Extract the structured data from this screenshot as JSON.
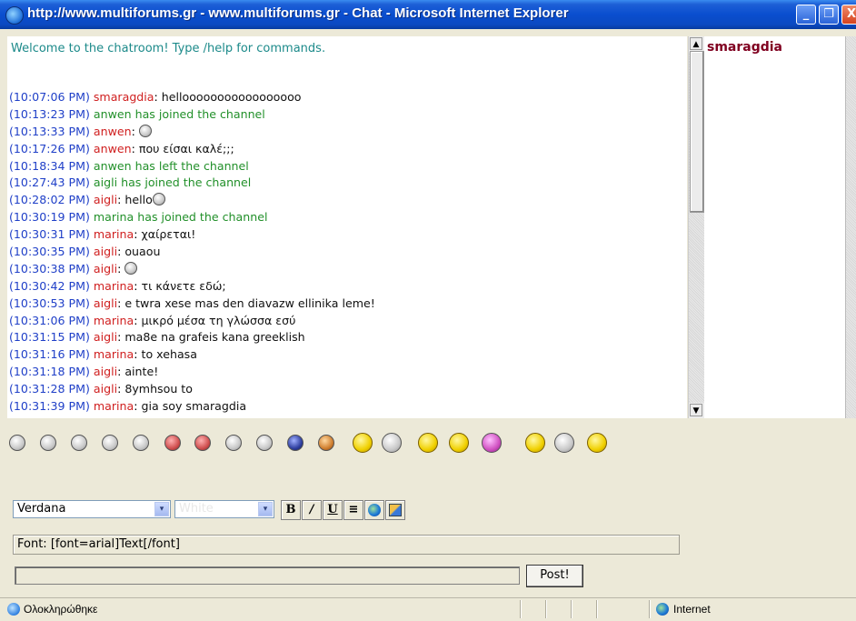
{
  "window": {
    "title": "http://www.multiforums.gr - www.multiforums.gr - Chat - Microsoft Internet Explorer",
    "min_glyph": "_",
    "max_glyph": "❐",
    "close_glyph": "X"
  },
  "chat": {
    "welcome": "Welcome to the chatroom! Type /help for commands.",
    "messages": [
      {
        "time": "(10:07:06 PM)",
        "nick": "smaragdia",
        "text": "hellooooooooooooooooo"
      },
      {
        "time": "(10:13:23 PM)",
        "system": "anwen has joined the channel"
      },
      {
        "time": "(10:13:33 PM)",
        "nick": "anwen",
        "text": "",
        "smiley": true
      },
      {
        "time": "(10:17:26 PM)",
        "nick": "anwen",
        "text": "που είσαι καλέ;;;"
      },
      {
        "time": "(10:18:34 PM)",
        "system": "anwen has left the channel"
      },
      {
        "time": "(10:27:43 PM)",
        "system": "aigli has joined the channel"
      },
      {
        "time": "(10:28:02 PM)",
        "nick": "aigli",
        "text": "hello",
        "smiley": true
      },
      {
        "time": "(10:30:19 PM)",
        "system": "marina has joined the channel"
      },
      {
        "time": "(10:30:31 PM)",
        "nick": "marina",
        "text": "χαίρεται!"
      },
      {
        "time": "(10:30:35 PM)",
        "nick": "aigli",
        "text": "ouaou"
      },
      {
        "time": "(10:30:38 PM)",
        "nick": "aigli",
        "text": "",
        "smiley": true
      },
      {
        "time": "(10:30:42 PM)",
        "nick": "marina",
        "text": "τι κάνετε εδώ;"
      },
      {
        "time": "(10:30:53 PM)",
        "nick": "aigli",
        "text": "e twra xese mas den diavazw ellinika leme!"
      },
      {
        "time": "(10:31:06 PM)",
        "nick": "marina",
        "text": "μικρό μέσα τη γλώσσα εσύ"
      },
      {
        "time": "(10:31:15 PM)",
        "nick": "aigli",
        "text": "ma8e na grafeis kana greeklish"
      },
      {
        "time": "(10:31:16 PM)",
        "nick": "marina",
        "text": "to xehasa"
      },
      {
        "time": "(10:31:18 PM)",
        "nick": "aigli",
        "text": "ainte!"
      },
      {
        "time": "(10:31:28 PM)",
        "nick": "aigli",
        "text": "8ymhsou to"
      },
      {
        "time": "(10:31:39 PM)",
        "nick": "marina",
        "text": "gia soy smaragdia"
      }
    ]
  },
  "users": {
    "list": [
      "smaragdia"
    ]
  },
  "emoticons": [
    {
      "name": "smile-emoticon",
      "style": ""
    },
    {
      "name": "sad-emoticon",
      "style": ""
    },
    {
      "name": "grin-emoticon",
      "style": ""
    },
    {
      "name": "happy-emoticon",
      "style": ""
    },
    {
      "name": "cool-emoticon",
      "style": ""
    },
    {
      "name": "angry-emoticon",
      "style": "d"
    },
    {
      "name": "shocked-emoticon",
      "style": "d"
    },
    {
      "name": "wow-emoticon",
      "style": ""
    },
    {
      "name": "tongue-emoticon",
      "style": ""
    },
    {
      "name": "ninja-emoticon",
      "style": "b"
    },
    {
      "name": "hat-emoticon",
      "style": "o"
    },
    {
      "name": "pair-emoticon",
      "style": "y"
    },
    {
      "name": "question-emoticon",
      "style": ""
    },
    {
      "name": "sign-emoticon",
      "style": "y"
    },
    {
      "name": "thumbsup-emoticon",
      "style": "y"
    },
    {
      "name": "cheerleader-emoticon",
      "style": "p"
    },
    {
      "name": "sunglasses-emoticon",
      "style": "y"
    },
    {
      "name": "confused-emoticon",
      "style": ""
    },
    {
      "name": "rock-emoticon",
      "style": "y"
    }
  ],
  "toolbar": {
    "font_select": "Verdana",
    "color_select": "White",
    "bold": "B",
    "italic": "/",
    "underline": "U",
    "align_glyph": "≡",
    "arrow_glyph": "▾"
  },
  "font_help": "Font: [font=arial]Text[/font]",
  "input": {
    "value": "",
    "post_label": "Post!"
  },
  "statusbar": {
    "text": "Ολοκληρώθηκε",
    "zone": "Internet"
  },
  "scrollbar": {
    "up_glyph": "▲",
    "down_glyph": "▼"
  }
}
